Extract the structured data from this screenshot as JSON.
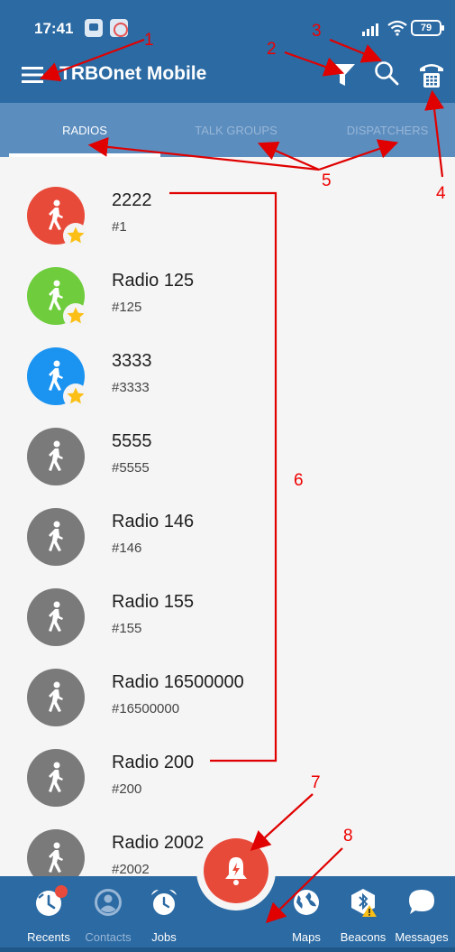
{
  "status_bar": {
    "time": "17:41",
    "battery": "79"
  },
  "app_bar": {
    "title": "TRBOnet Mobile"
  },
  "tabs": [
    {
      "label": "RADIOS",
      "active": true
    },
    {
      "label": "TALK GROUPS",
      "active": false
    },
    {
      "label": "DISPATCHERS",
      "active": false
    }
  ],
  "radios": [
    {
      "name": "2222",
      "id": "#1",
      "color": "#e84a3a",
      "favorite": true
    },
    {
      "name": "Radio 125",
      "id": "#125",
      "color": "#6fcc3d",
      "favorite": true
    },
    {
      "name": "3333",
      "id": "#3333",
      "color": "#1b93f0",
      "favorite": true
    },
    {
      "name": "5555",
      "id": "#5555",
      "color": "#7a7a7a",
      "favorite": false
    },
    {
      "name": "Radio 146",
      "id": "#146",
      "color": "#7a7a7a",
      "favorite": false
    },
    {
      "name": "Radio 155",
      "id": "#155",
      "color": "#7a7a7a",
      "favorite": false
    },
    {
      "name": "Radio 16500000",
      "id": "#16500000",
      "color": "#7a7a7a",
      "favorite": false
    },
    {
      "name": "Radio 200",
      "id": "#200",
      "color": "#7a7a7a",
      "favorite": false
    },
    {
      "name": "Radio 2002",
      "id": "#2002",
      "color": "#7a7a7a",
      "favorite": false
    }
  ],
  "bottom_nav": [
    {
      "label": "Recents",
      "icon": "recents-icon"
    },
    {
      "label": "Contacts",
      "icon": "contacts-icon"
    },
    {
      "label": "Jobs",
      "icon": "alarm-clock-icon"
    },
    {
      "label": "Maps",
      "icon": "globe-icon"
    },
    {
      "label": "Beacons",
      "icon": "bluetooth-beacon-icon"
    },
    {
      "label": "Messages",
      "icon": "chat-bubble-icon"
    }
  ],
  "annotations": [
    "1",
    "2",
    "3",
    "4",
    "5",
    "6",
    "7",
    "8"
  ],
  "colors": {
    "primary": "#2b6aa3",
    "tab_bar": "#5b8dbf",
    "alarm": "#e84a3a",
    "annotation": "#e00000"
  }
}
